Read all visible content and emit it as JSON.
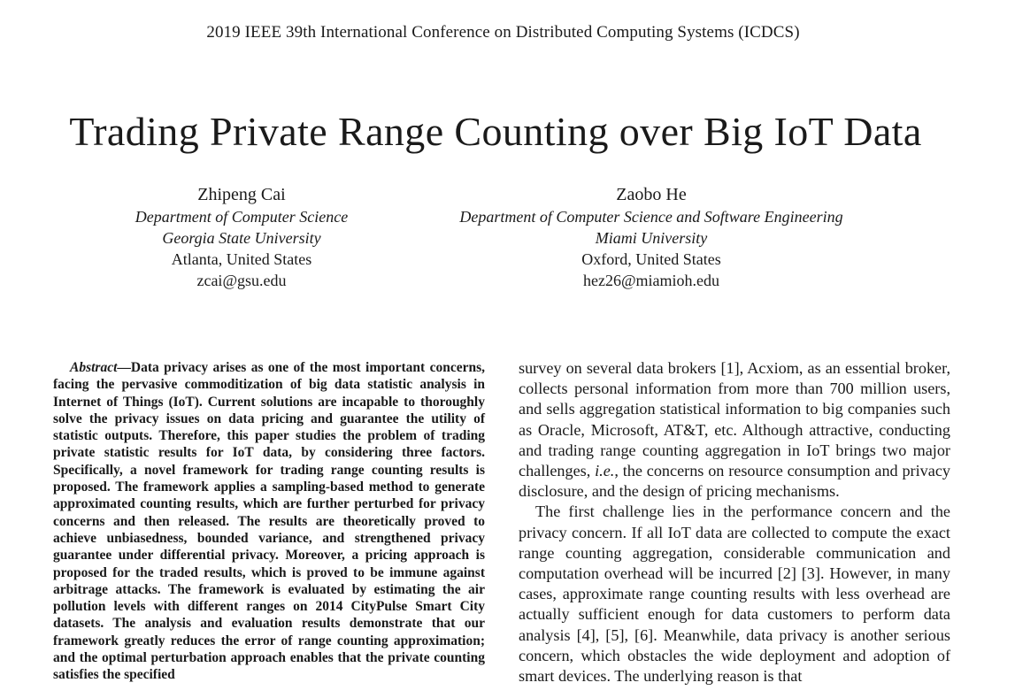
{
  "header": {
    "conference": "2019 IEEE 39th International Conference on Distributed Computing Systems (ICDCS)"
  },
  "paper": {
    "title": "Trading Private Range Counting over Big IoT Data",
    "authors": [
      {
        "name": "Zhipeng Cai",
        "department": "Department of Computer Science",
        "university": "Georgia State University",
        "location": "Atlanta, United States",
        "email": "zcai@gsu.edu"
      },
      {
        "name": "Zaobo He",
        "department": "Department of Computer Science and Software Engineering",
        "university": "Miami University",
        "location": "Oxford, United States",
        "email": "hez26@miamioh.edu"
      }
    ],
    "abstract": {
      "label": "Abstract",
      "dash": "—",
      "text": "Data privacy arises as one of the most important concerns, facing the pervasive commoditization of big data statistic analysis in Internet of Things (IoT). Current solutions are incapable to thoroughly solve the privacy issues on data pricing and guarantee the utility of statistic outputs. Therefore, this paper studies the problem of trading private statistic results for IoT data, by considering three factors. Specifically, a novel framework for trading range counting results is proposed. The framework applies a sampling-based method to generate approx­imated counting results, which are further perturbed for privacy concerns and then released. The results are theoretically proved to achieve unbiasedness, bounded variance, and strengthened privacy guarantee under differential privacy. Moreover, a pricing approach is proposed for the traded results, which is proved to be immune against arbitrage attacks. The framework is evaluated by estimating the air pollution levels with different ranges on 2014 CityPulse Smart City datasets. The analysis and evaluation results demonstrate that our framework greatly reduces the error of range counting approximation; and the optimal perturbation approach enables that the private counting satisfies the specified"
    },
    "body": {
      "para1_part1": "survey on several data brokers [1], Acxiom, as an essential broker, collects personal information from more than 700 million users, and sells aggregation statistical information to big companies such as Oracle, Microsoft, AT&T, etc. Although attractive, conducting and trading range counting aggregation in IoT brings two major challenges, ",
      "para1_ie": "i.e.",
      "para1_part2": ", the concerns on resource consumption and privacy disclosure, and the design of pricing mechanisms.",
      "para2": "The first challenge lies in the performance concern and the privacy concern. If all IoT data are collected to compute the exact range counting aggregation, considerable communication and computation overhead will be incurred [2] [3]. However, in many cases, approximate range counting results with less overhead are actually sufficient enough for data customers to perform data analysis [4], [5], [6]. Meanwhile, data privacy is another serious concern, which obstacles the wide deployment and adoption of smart devices. The underlying reason is that"
    }
  }
}
